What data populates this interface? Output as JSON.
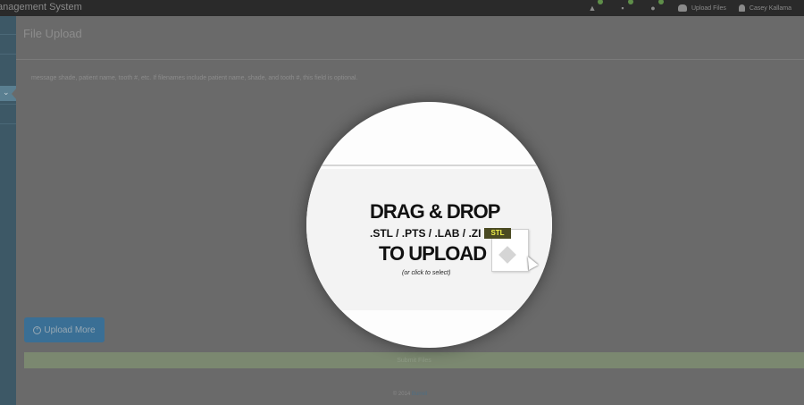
{
  "navbar": {
    "brand": "anagement System",
    "icons": [
      {
        "name": "notification-icon",
        "glyph": "▲"
      },
      {
        "name": "tasks-icon",
        "glyph": "▪"
      },
      {
        "name": "messages-icon",
        "glyph": "●"
      }
    ],
    "upload_link": "Upload Files",
    "user_name": "Casey Kallama"
  },
  "page": {
    "title": "File Upload",
    "instructions": "message shade, patient name, tooth #, etc. If filenames include patient name, shade, and tooth #, this field is optional."
  },
  "dropzone": {
    "line1": "DRAG & DROP",
    "line2": ".STL / .PTS / .LAB / .ZI",
    "line3": "TO UPLOAD",
    "hint": "(or click to select)",
    "file_tag": "STL"
  },
  "buttons": {
    "upload_more": "Upload More",
    "submit": "Submit Files"
  },
  "footer": {
    "copyright": "© 2014",
    "link": "Burrell"
  },
  "colors": {
    "sidebar": "#3d5866",
    "primary_button": "#3a6f95",
    "submit_bar": "#7b8870",
    "file_tag_bg": "#4a4a22",
    "file_tag_text": "#f2f24a"
  }
}
